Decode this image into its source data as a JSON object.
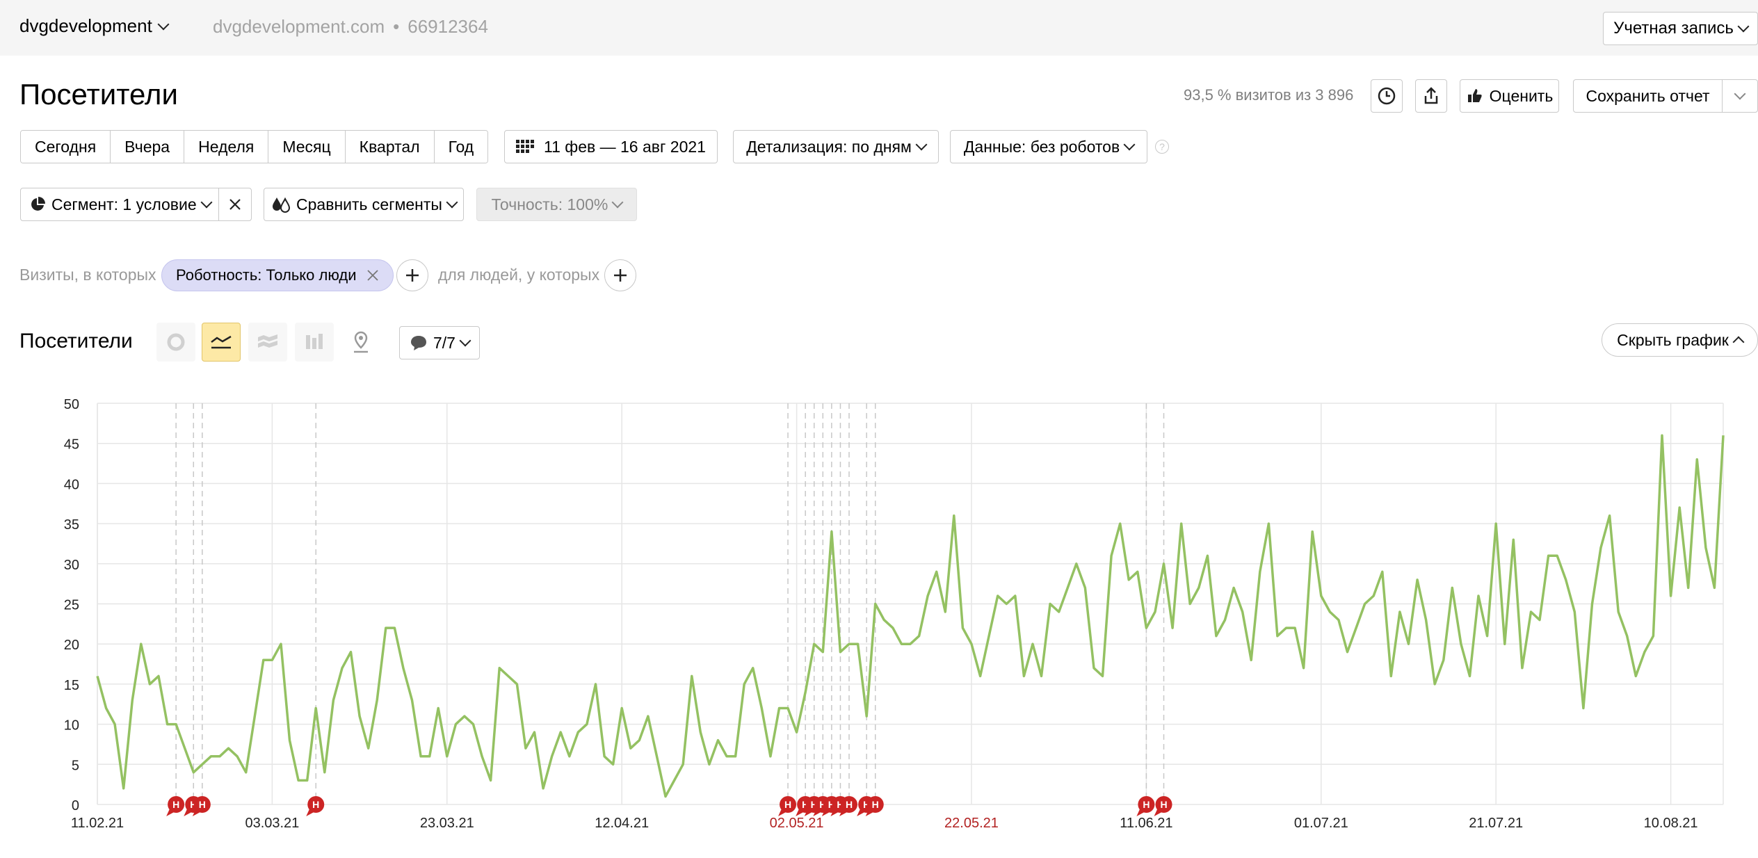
{
  "topbar": {
    "counter_name": "dvgdevelopment",
    "site": "dvgdevelopment.com",
    "separator": "•",
    "counter_id": "66912364",
    "account_label": "Учетная запись"
  },
  "header": {
    "title": "Посетители",
    "visits_info": "93,5 % визитов из 3 896",
    "rate_label": "Оценить",
    "save_label": "Сохранить отчет"
  },
  "periods": [
    "Сегодня",
    "Вчера",
    "Неделя",
    "Месяц",
    "Квартал",
    "Год"
  ],
  "date_range": "11 фев — 16 авг 2021",
  "detail_label": "Детализация: по дням",
  "data_label": "Данные: без роботов",
  "help_icon": "?",
  "segment": {
    "label": "Сегмент: 1 условие",
    "compare_label": "Сравнить сегменты",
    "accuracy_label": "Точность: 100%"
  },
  "filter": {
    "prefix": "Визиты, в которых",
    "chip": "Роботность: Только люди",
    "suffix": "для людей, у которых"
  },
  "chart_section": {
    "title": "Посетители",
    "notes_label": "7/7",
    "hide_label": "Скрыть график",
    "marker_letter": "Н"
  },
  "colors": {
    "series": "#94c162",
    "marker": "#cc2424",
    "highlight_date": "#b22222",
    "active_view": "#fde9a6"
  },
  "chart_data": {
    "type": "line",
    "title": "",
    "xlabel": "",
    "ylabel": "",
    "ylim": [
      0,
      50
    ],
    "yticks": [
      0,
      5,
      10,
      15,
      20,
      25,
      30,
      35,
      40,
      45,
      50
    ],
    "x_range": [
      "2021-02-11",
      "2021-08-16"
    ],
    "x_tick_labels": [
      {
        "date": "2021-02-11",
        "label": "11.02.21",
        "highlight": false
      },
      {
        "date": "2021-03-03",
        "label": "03.03.21",
        "highlight": false
      },
      {
        "date": "2021-03-23",
        "label": "23.03.21",
        "highlight": false
      },
      {
        "date": "2021-04-12",
        "label": "12.04.21",
        "highlight": false
      },
      {
        "date": "2021-05-02",
        "label": "02.05.21",
        "highlight": true
      },
      {
        "date": "2021-05-22",
        "label": "22.05.21",
        "highlight": true
      },
      {
        "date": "2021-06-11",
        "label": "11.06.21",
        "highlight": false
      },
      {
        "date": "2021-07-01",
        "label": "01.07.21",
        "highlight": false
      },
      {
        "date": "2021-07-21",
        "label": "21.07.21",
        "highlight": false
      },
      {
        "date": "2021-08-10",
        "label": "10.08.21",
        "highlight": false
      }
    ],
    "grid": true,
    "series": [
      {
        "start_date": "2021-02-11",
        "values": [
          16,
          12,
          10,
          2,
          13,
          20,
          15,
          16,
          10,
          10,
          7,
          4,
          5,
          6,
          6,
          7,
          6,
          4,
          11,
          18,
          18,
          20,
          8,
          3,
          3,
          12,
          4,
          13,
          17,
          19,
          11,
          7,
          13,
          22,
          22,
          17,
          13,
          6,
          6,
          12,
          6,
          10,
          11,
          10,
          6,
          3,
          17,
          16,
          15,
          7,
          9,
          2,
          6,
          9,
          6,
          9,
          10,
          15,
          6,
          5,
          12,
          7,
          8,
          11,
          6,
          1,
          3,
          5,
          16,
          9,
          5,
          8,
          6,
          6,
          15,
          17,
          12,
          6,
          12,
          12,
          9,
          14,
          20,
          19,
          34,
          19,
          20,
          20,
          11,
          25,
          23,
          22,
          20,
          20,
          21,
          26,
          29,
          24,
          36,
          22,
          20,
          16,
          21,
          26,
          25,
          26,
          16,
          20,
          16,
          25,
          24,
          27,
          30,
          27,
          17,
          16,
          31,
          35,
          28,
          29,
          22,
          24,
          30,
          22,
          35,
          25,
          27,
          31,
          21,
          23,
          27,
          24,
          18,
          29,
          35,
          21,
          22,
          22,
          17,
          34,
          26,
          24,
          23,
          19,
          22,
          25,
          26,
          29,
          16,
          24,
          20,
          28,
          23,
          15,
          18,
          27,
          20,
          16,
          26,
          21,
          35,
          20,
          33,
          17,
          24,
          23,
          31,
          31,
          28,
          24,
          12,
          25,
          32,
          36,
          24,
          21,
          16,
          19,
          21,
          46,
          26,
          37,
          27,
          43,
          32,
          27,
          46
        ]
      }
    ],
    "annotation_dates": [
      "2021-02-20",
      "2021-02-22",
      "2021-02-23",
      "2021-03-08",
      "2021-05-01",
      "2021-05-03",
      "2021-05-04",
      "2021-05-05",
      "2021-05-06",
      "2021-05-07",
      "2021-05-08",
      "2021-05-10",
      "2021-05-11",
      "2021-06-11",
      "2021-06-13"
    ]
  }
}
